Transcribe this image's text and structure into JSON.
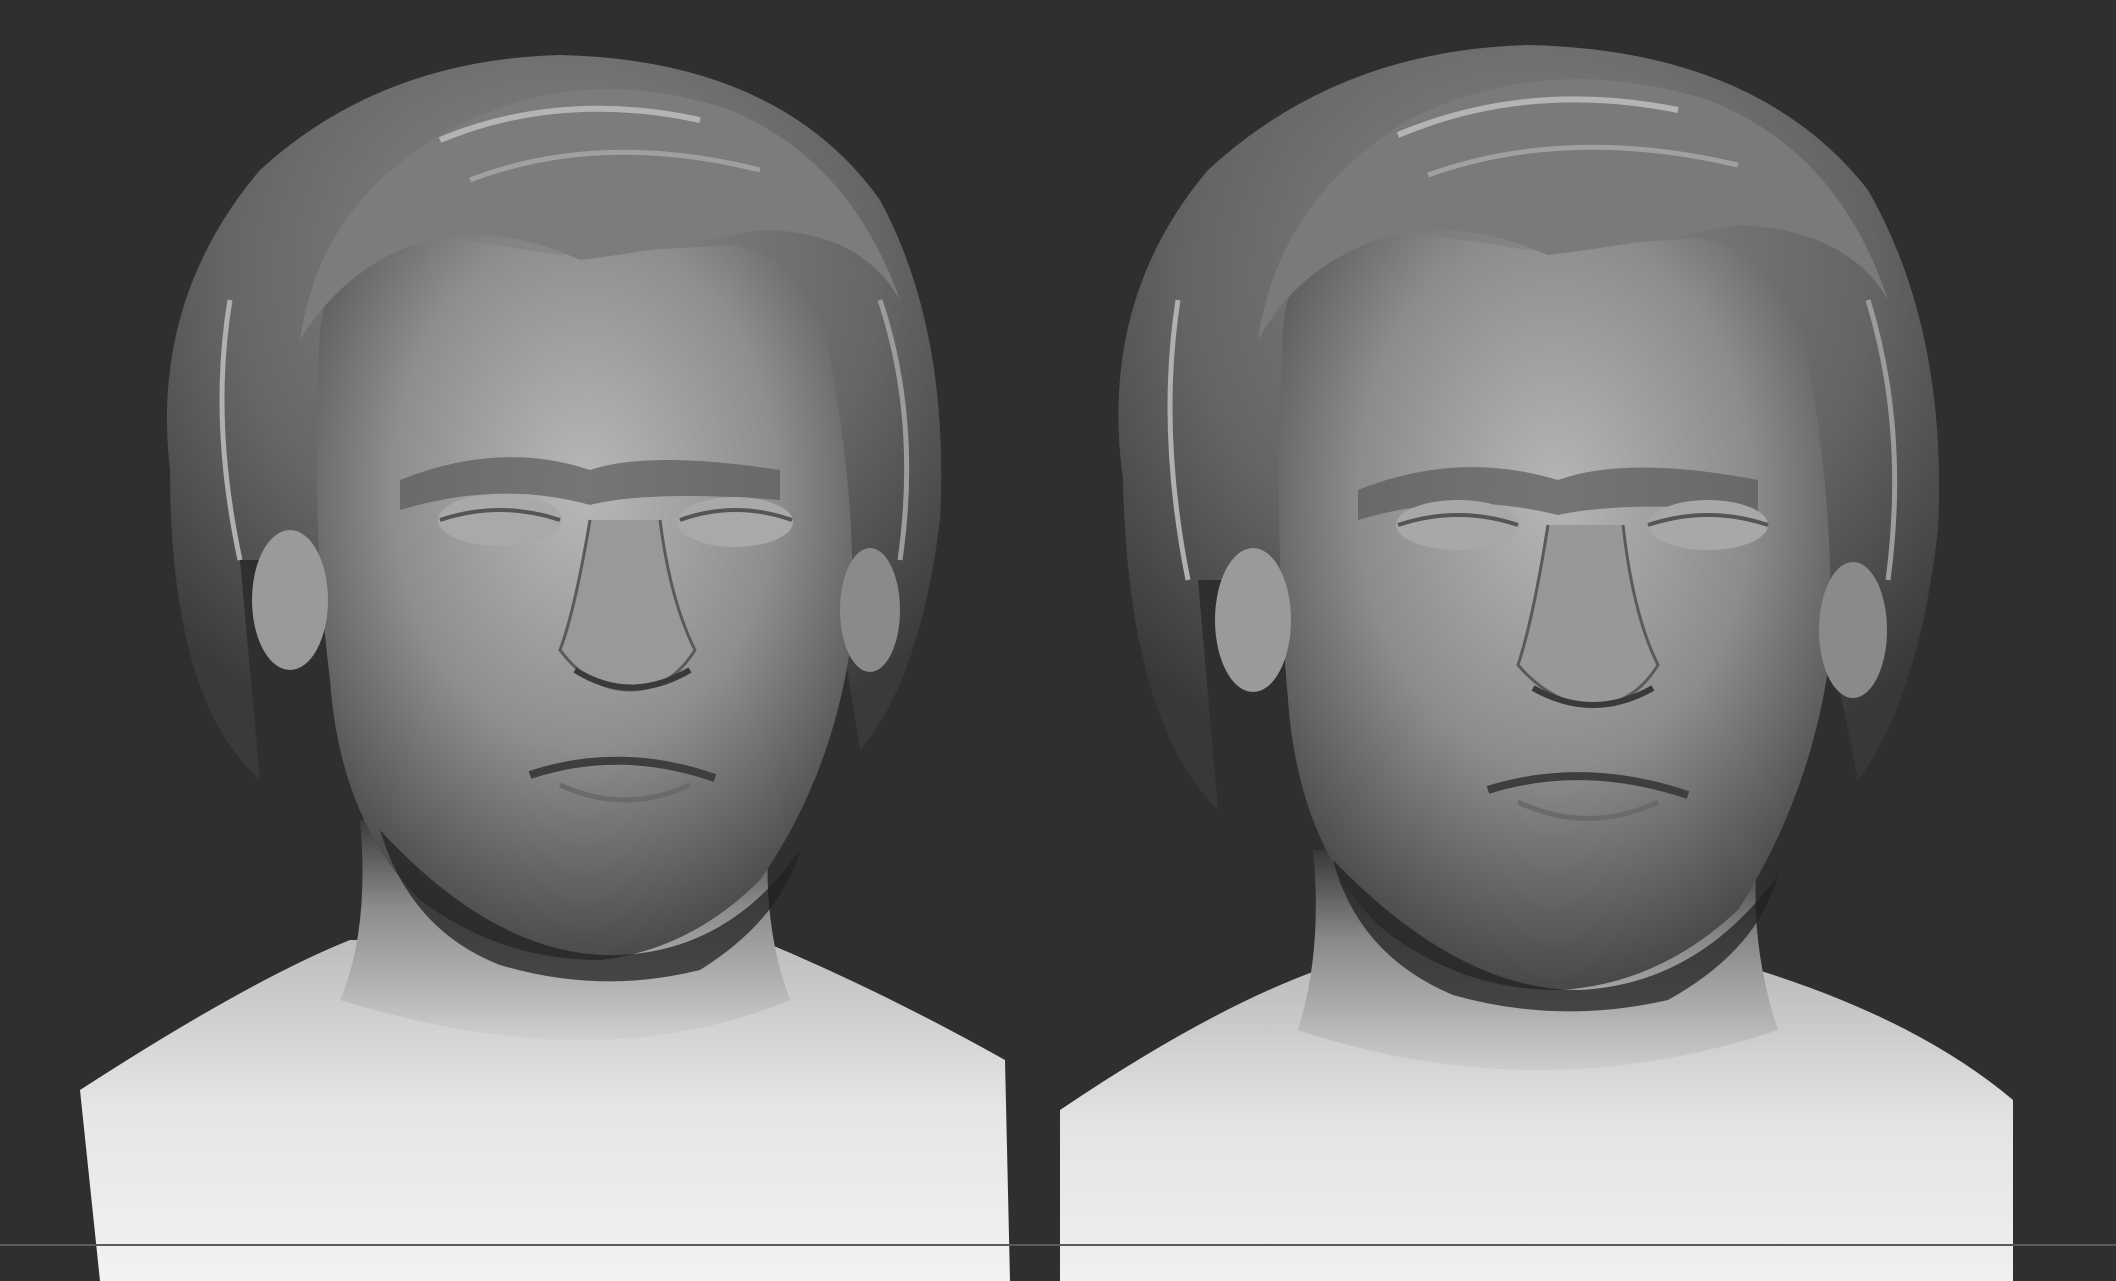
{
  "scene": {
    "background_color": "#2f2f2f",
    "material_color": "#9a9a9a",
    "highlight_color": "#ececec",
    "shadow_color": "#1e1e1e",
    "views": [
      {
        "name": "bust-front-view-a"
      },
      {
        "name": "bust-front-view-b"
      }
    ]
  }
}
